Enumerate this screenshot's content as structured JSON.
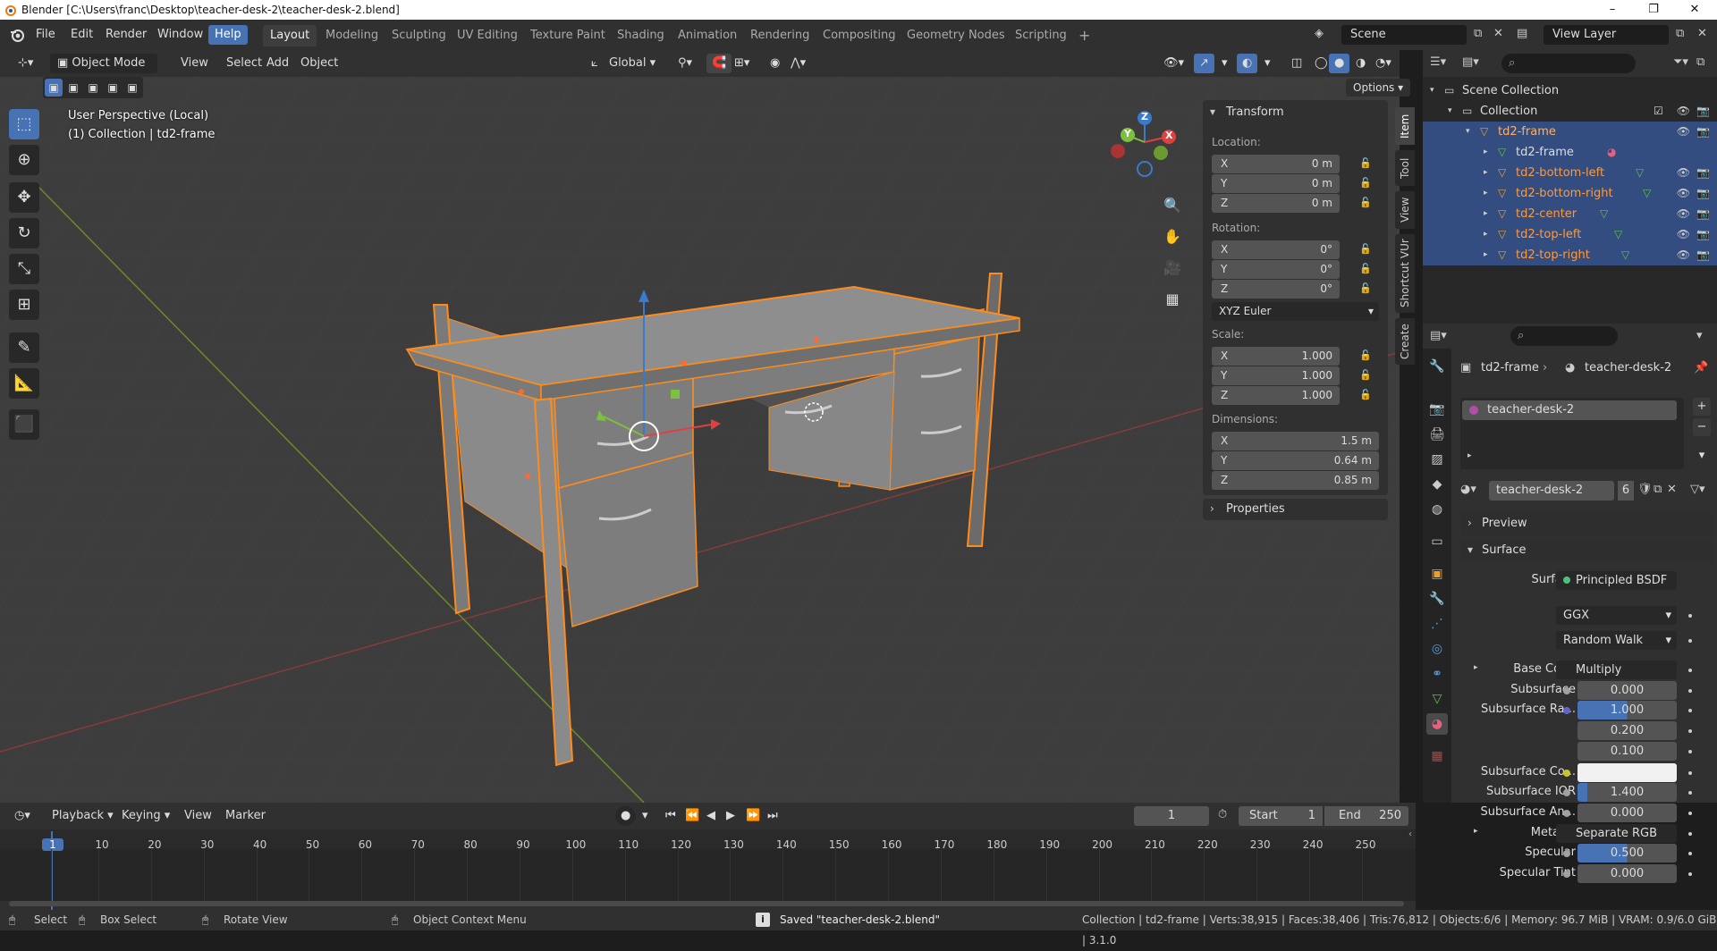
{
  "window": {
    "title": "Blender [C:\\Users\\franc\\Desktop\\teacher-desk-2\\teacher-desk-2.blend]",
    "controls": [
      "–",
      "❐",
      "✕"
    ]
  },
  "menus": [
    "File",
    "Edit",
    "Render",
    "Window",
    "Help"
  ],
  "workspaces": [
    "Layout",
    "Modeling",
    "Sculpting",
    "UV Editing",
    "Texture Paint",
    "Shading",
    "Animation",
    "Rendering",
    "Compositing",
    "Geometry Nodes",
    "Scripting",
    "+"
  ],
  "scene": {
    "label": "Scene",
    "view_layer": "View Layer"
  },
  "viewport_header": {
    "mode": "Object Mode",
    "menus": [
      "View",
      "Select",
      "Add",
      "Object"
    ],
    "transform_orientation": "Global",
    "options": "Options"
  },
  "viewport_overlay": {
    "perspective": "User Perspective (Local)",
    "context": "(1) Collection | td2-frame"
  },
  "gizmo": {
    "x": "X",
    "y": "Y",
    "z": "Z"
  },
  "npanel": {
    "transform_title": "Transform",
    "location_label": "Location:",
    "location": [
      {
        "axis": "X",
        "value": "0 m"
      },
      {
        "axis": "Y",
        "value": "0 m"
      },
      {
        "axis": "Z",
        "value": "0 m"
      }
    ],
    "rotation_label": "Rotation:",
    "rotation": [
      {
        "axis": "X",
        "value": "0°"
      },
      {
        "axis": "Y",
        "value": "0°"
      },
      {
        "axis": "Z",
        "value": "0°"
      }
    ],
    "rotation_mode": "XYZ Euler",
    "scale_label": "Scale:",
    "scale": [
      {
        "axis": "X",
        "value": "1.000"
      },
      {
        "axis": "Y",
        "value": "1.000"
      },
      {
        "axis": "Z",
        "value": "1.000"
      }
    ],
    "dimensions_label": "Dimensions:",
    "dimensions": [
      {
        "axis": "X",
        "value": "1.5 m"
      },
      {
        "axis": "Y",
        "value": "0.64 m"
      },
      {
        "axis": "Z",
        "value": "0.85 m"
      }
    ],
    "properties_title": "Properties",
    "tabs": [
      "Item",
      "Tool",
      "View",
      "Shortcut VUr",
      "Create"
    ]
  },
  "outliner": {
    "rows": [
      {
        "name": "Scene Collection",
        "indent": 0
      },
      {
        "name": "Collection",
        "indent": 1
      },
      {
        "name": "td2-frame",
        "indent": 2,
        "selected": true,
        "orange": true
      },
      {
        "name": "td2-frame",
        "indent": 3,
        "selected": true,
        "mesh": true
      },
      {
        "name": "td2-bottom-left",
        "indent": 3,
        "selected": true,
        "orange": true
      },
      {
        "name": "td2-bottom-right",
        "indent": 3,
        "selected": true,
        "orange": true
      },
      {
        "name": "td2-center",
        "indent": 3,
        "selected": true,
        "orange": true
      },
      {
        "name": "td2-top-left",
        "indent": 3,
        "selected": true,
        "orange": true
      },
      {
        "name": "td2-top-right",
        "indent": 3,
        "selected": true,
        "orange": true
      }
    ]
  },
  "properties": {
    "breadcrumb_object": "td2-frame",
    "breadcrumb_material": "teacher-desk-2",
    "slot_name": "teacher-desk-2",
    "material_name": "teacher-desk-2",
    "material_users": "6",
    "preview": "Preview",
    "surface_panel": "Surface",
    "surface_label": "Surface",
    "surface_value": "Principled BSDF",
    "distribution": "GGX",
    "subsurface_method": "Random Walk",
    "rows": [
      {
        "label": "Base Color",
        "value": "Multiply",
        "type": "link",
        "dot": "#c7c729"
      },
      {
        "label": "Subsurface",
        "value": "0.000",
        "type": "num",
        "dot": "#a1a1a1"
      },
      {
        "label": "Subsurface Ra...",
        "value": "1.000",
        "type": "num",
        "dot": "#6363c7"
      },
      {
        "label": "",
        "value": "0.200",
        "type": "num"
      },
      {
        "label": "",
        "value": "0.100",
        "type": "num"
      },
      {
        "label": "Subsurface Co...",
        "value": "",
        "type": "color",
        "dot": "#c7c729"
      },
      {
        "label": "Subsurface IOR",
        "value": "1.400",
        "type": "num",
        "dot": "#a1a1a1"
      },
      {
        "label": "Subsurface An...",
        "value": "0.000",
        "type": "num",
        "dot": "#a1a1a1"
      },
      {
        "label": "Metallic",
        "value": "Separate RGB",
        "type": "link",
        "dot": "#a1a1a1"
      },
      {
        "label": "Specular",
        "value": "0.500",
        "type": "num",
        "dot": "#a1a1a1"
      },
      {
        "label": "Specular Tint",
        "value": "0.000",
        "type": "num",
        "dot": "#a1a1a1"
      }
    ]
  },
  "timeline": {
    "menus": [
      "Playback",
      "Keying",
      "View",
      "Marker"
    ],
    "current_frame": "1",
    "start_label": "Start",
    "start": "1",
    "end_label": "End",
    "end": "250",
    "ticks": [
      "1",
      "10",
      "20",
      "30",
      "40",
      "50",
      "60",
      "70",
      "80",
      "90",
      "100",
      "110",
      "120",
      "130",
      "140",
      "150",
      "160",
      "170",
      "180",
      "190",
      "200",
      "210",
      "220",
      "230",
      "240",
      "250"
    ]
  },
  "statusbar": {
    "select": "Select",
    "box_select": "Box Select",
    "rotate": "Rotate View",
    "context_menu": "Object Context Menu",
    "message": "Saved \"teacher-desk-2.blend\"",
    "stats": "Collection | td2-frame | Verts:38,915 | Faces:38,406 | Tris:76,812 | Objects:6/6 | Memory: 96.7 MiB | VRAM: 0.9/6.0 GiB | 3.1.0"
  },
  "colors": {
    "accent": "#4772b3",
    "selection": "#ff8c1a",
    "bg": "#3d3d3d"
  }
}
